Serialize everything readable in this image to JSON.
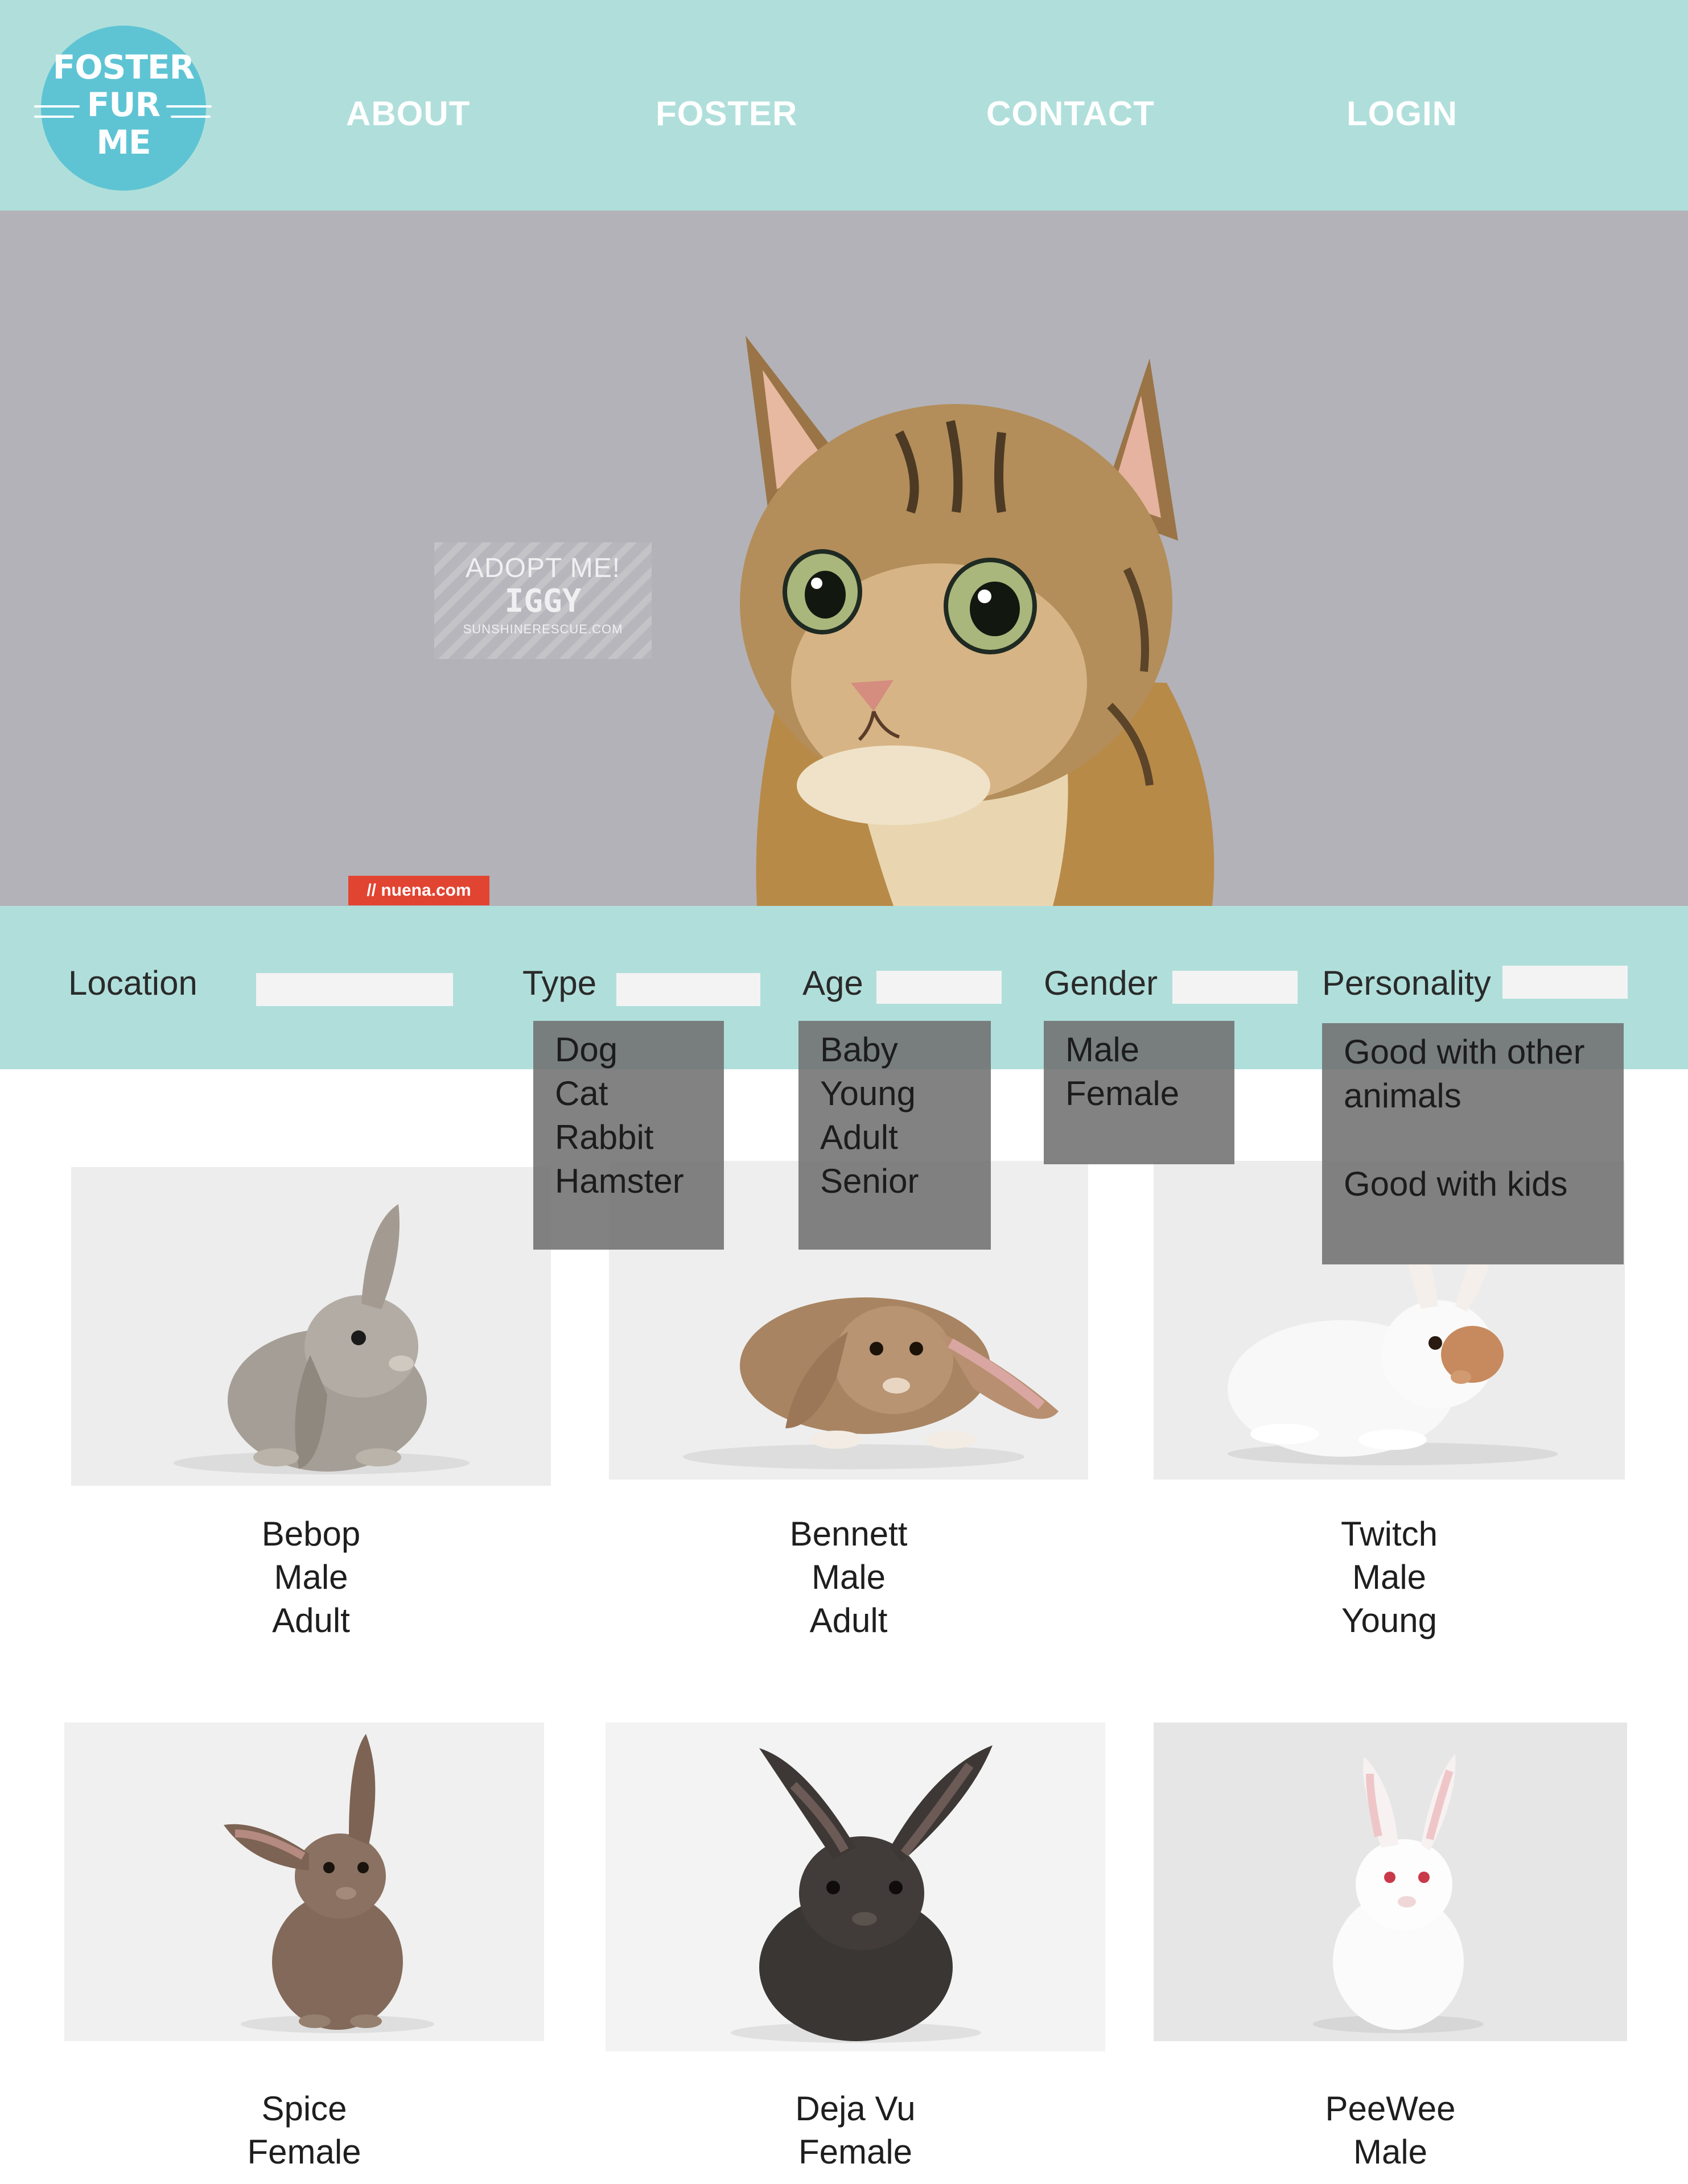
{
  "header": {
    "logo_text": "FOSTER\nFUR\nME",
    "nav": [
      "ABOUT",
      "FOSTER",
      "CONTACT",
      "LOGIN"
    ],
    "colors": {
      "bar": "#b0dfdb",
      "logo": "#5ec4d4"
    }
  },
  "hero": {
    "badge_line1": "ADOPT ME!",
    "badge_line2": "IGGY",
    "badge_line3": "SUNSHINERESCUE.COM",
    "credit": "// nuena.com",
    "image": "tabby-cat-photo"
  },
  "filters": {
    "location_label": "Location",
    "type_label": "Type",
    "age_label": "Age",
    "gender_label": "Gender",
    "personality_label": "Personality",
    "type_options": [
      "Dog",
      "Cat",
      "Rabbit",
      "Hamster"
    ],
    "age_options": [
      "Baby",
      "Young",
      "Adult",
      "Senior"
    ],
    "gender_options": [
      "Male",
      "Female"
    ],
    "personality_options": [
      "Good with other animals",
      "Good with kids"
    ]
  },
  "pets": [
    {
      "name": "Bebop",
      "gender": "Male",
      "age": "Adult",
      "image": "grey-lop-rabbit"
    },
    {
      "name": "Bennett",
      "gender": "Male",
      "age": "Adult",
      "image": "brown-lop-rabbit"
    },
    {
      "name": "Twitch",
      "gender": "Male",
      "age": "Young",
      "image": "white-rabbit"
    },
    {
      "name": "Spice",
      "gender": "Female",
      "age": "",
      "image": "brown-rabbit"
    },
    {
      "name": "Deja Vu",
      "gender": "Female",
      "age": "",
      "image": "black-rabbit"
    },
    {
      "name": "PeeWee",
      "gender": "Male",
      "age": "",
      "image": "white-rabbit-red-eyes"
    }
  ]
}
